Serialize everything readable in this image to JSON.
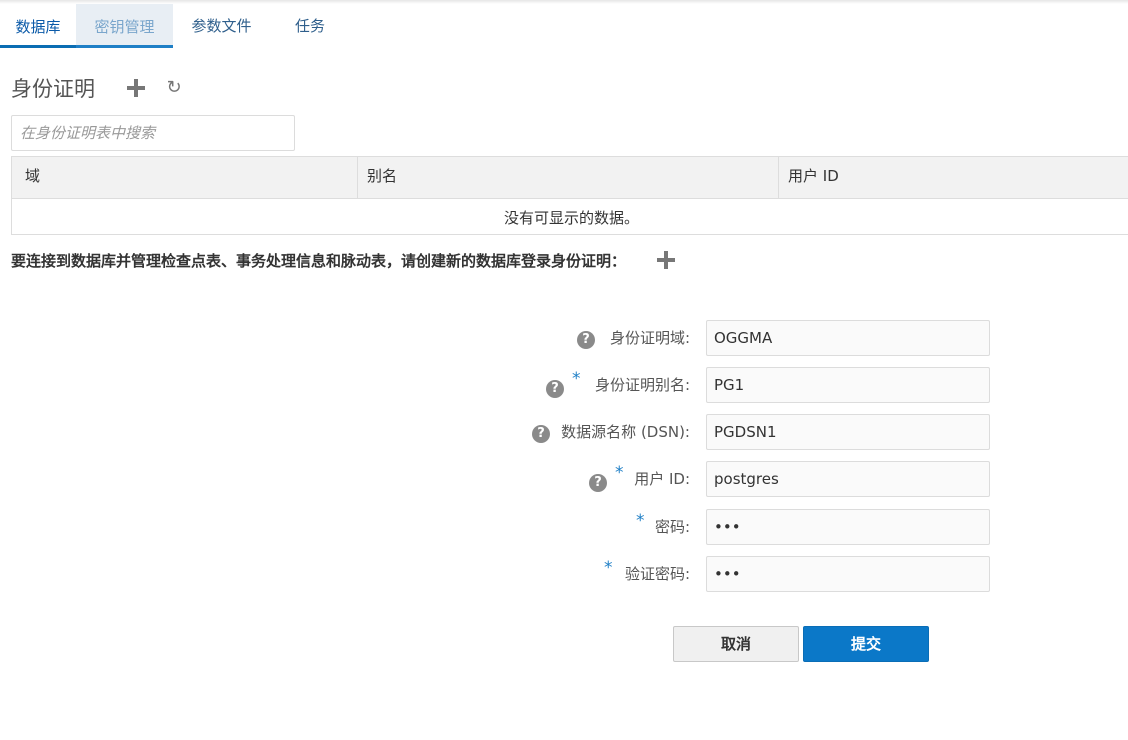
{
  "tabs": [
    {
      "label": "数据库"
    },
    {
      "label": "密钥管理"
    },
    {
      "label": "参数文件"
    },
    {
      "label": "任务"
    }
  ],
  "section": {
    "title": "身份证明"
  },
  "search": {
    "placeholder": "在身份证明表中搜索"
  },
  "table": {
    "columns": [
      "域",
      "别名",
      "用户 ID"
    ],
    "empty_message": "没有可显示的数据。"
  },
  "instruction": "要连接到数据库并管理检查点表、事务处理信息和脉动表，请创建新的数据库登录身份证明：",
  "form": {
    "fields": [
      {
        "label": "身份证明域:",
        "value": "OGGMA",
        "required": false,
        "help": true
      },
      {
        "label": "身份证明别名:",
        "value": "PG1",
        "required": true,
        "help": true
      },
      {
        "label": "数据源名称 (DSN):",
        "value": "PGDSN1",
        "required": false,
        "help": true
      },
      {
        "label": "用户 ID:",
        "value": "postgres",
        "required": true,
        "help": true
      },
      {
        "label": "密码:",
        "value": "•••",
        "required": true,
        "help": false
      },
      {
        "label": "验证密码:",
        "value": "•••",
        "required": true,
        "help": false
      }
    ],
    "required_mark": "*",
    "help_glyph": "?",
    "cancel_label": "取消",
    "submit_label": "提交"
  },
  "icons": {
    "refresh": "↻"
  },
  "colors": {
    "accent": "#0b78c8",
    "tab_active_bg": "#e8eef4"
  }
}
